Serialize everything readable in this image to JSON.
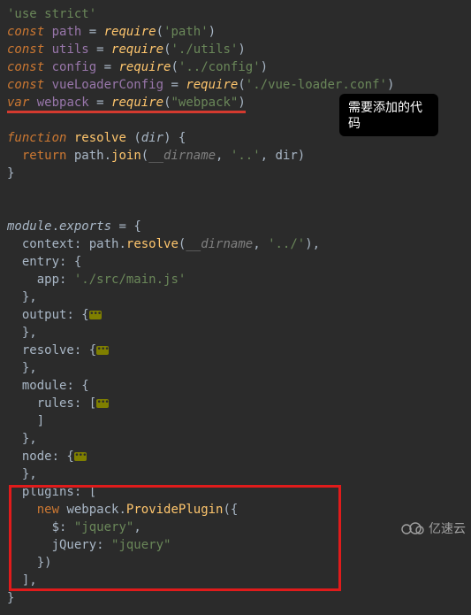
{
  "tooltip": "需要添加的代码",
  "watermark": "亿速云",
  "code": {
    "l1": "'use strict'",
    "l2_kw": "const",
    "l2_var": "path",
    "l2_eq": " = ",
    "l2_fn": "require",
    "l2_arg": "'path'",
    "l3_kw": "const",
    "l3_var": "utils",
    "l3_eq": " = ",
    "l3_fn": "require",
    "l3_arg": "'./utils'",
    "l4_kw": "const",
    "l4_var": "config",
    "l4_eq": " = ",
    "l4_fn": "require",
    "l4_arg": "'../config'",
    "l5_kw": "const",
    "l5_var": "vueLoaderConfig",
    "l5_eq": " = ",
    "l5_fn": "require",
    "l5_arg": "'./vue-loader.conf'",
    "l6_kw": "var",
    "l6_var": "webpack",
    "l6_eq": " = ",
    "l6_fn": "require",
    "l6_arg": "\"webpack\"",
    "l8_kw": "function",
    "l8_name": "resolve",
    "l8_param": "dir",
    "l9_kw": "return",
    "l9_obj": "path",
    "l9_fn": "join",
    "l9_g": "__dirname",
    "l9_s1": "'..'",
    "l9_v": "dir",
    "l13_obj": "module",
    "l13_prop": "exports",
    "l14_key": "context",
    "l14_obj": "path",
    "l14_fn": "resolve",
    "l14_g": "__dirname",
    "l14_s": "'../'",
    "l15_key": "entry",
    "l16_key": "app",
    "l16_val": "'./src/main.js'",
    "l18_key": "output",
    "l20_key": "resolve",
    "l22_key": "module",
    "l23_key": "rules",
    "l26_key": "node",
    "l28_key": "plugins",
    "l29_kw": "new",
    "l29_obj": "webpack",
    "l29_fn": "ProvidePlugin",
    "l30_key": "$",
    "l30_val": "\"jquery\"",
    "l31_key": "jQuery",
    "l31_val": "\"jquery\""
  },
  "chart_data": {
    "type": "table",
    "note": "Highlighted (must-add) code block inside red rectangle",
    "lines": [
      "plugins: [",
      "  new webpack.ProvidePlugin({",
      "    $: \"jquery\",",
      "    jQuery: \"jquery\"",
      "  })",
      "],"
    ]
  }
}
